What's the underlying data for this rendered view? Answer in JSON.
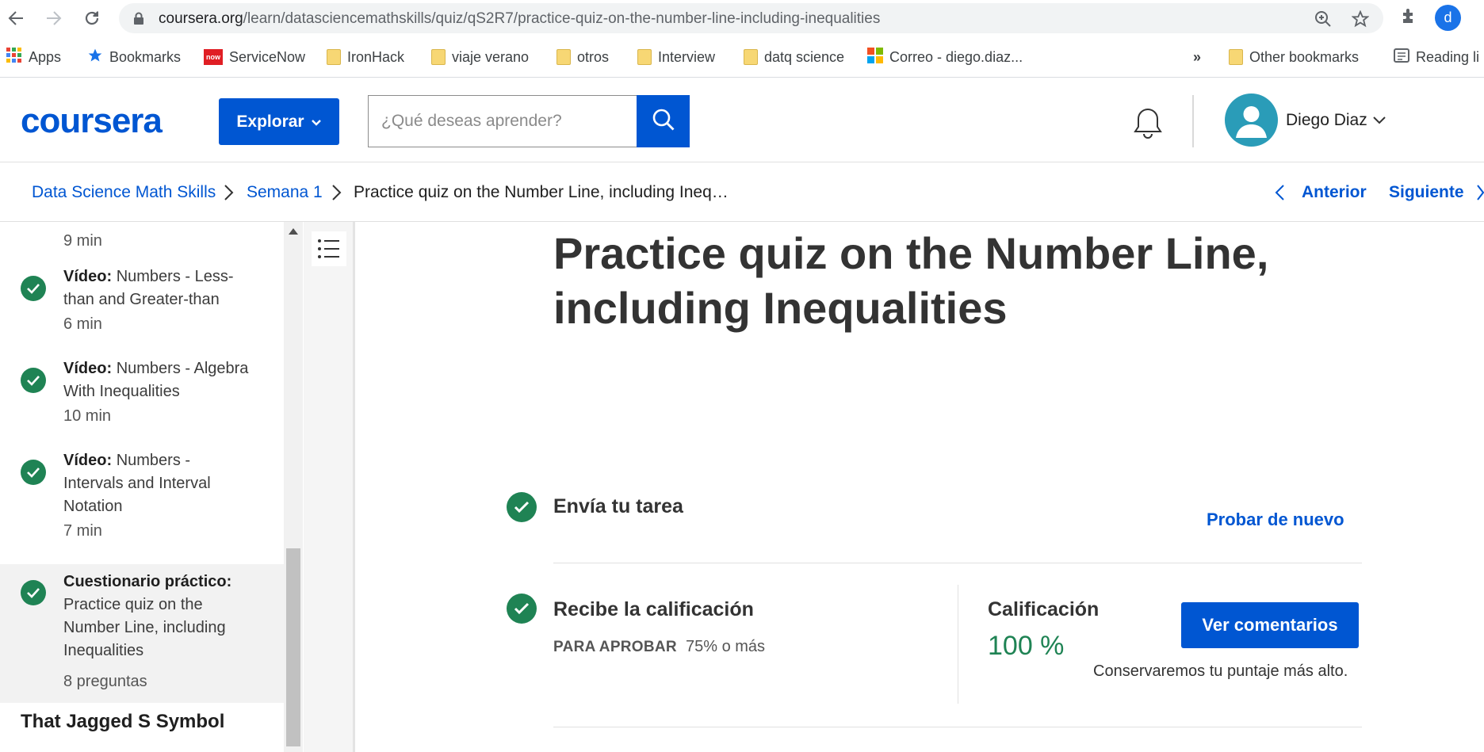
{
  "browser": {
    "url_host": "coursera.org",
    "url_path": "/learn/datasciencemathskills/quiz/qS2R7/practice-quiz-on-the-number-line-including-inequalities",
    "profile_initial": "d"
  },
  "bookmarks": {
    "items": [
      {
        "label": "Apps",
        "icon": "apps-grid-icon"
      },
      {
        "label": "Bookmarks",
        "icon": "star-icon"
      },
      {
        "label": "ServiceNow",
        "icon": "servicenow-icon",
        "badge": "now"
      },
      {
        "label": "IronHack",
        "icon": "folder-icon"
      },
      {
        "label": "viaje verano",
        "icon": "folder-icon"
      },
      {
        "label": "otros",
        "icon": "folder-icon"
      },
      {
        "label": "Interview",
        "icon": "folder-icon"
      },
      {
        "label": "datq science",
        "icon": "folder-icon"
      },
      {
        "label": "Correo - diego.diaz...",
        "icon": "microsoft-icon"
      }
    ],
    "overflow": "»",
    "other": "Other bookmarks",
    "reading": "Reading li"
  },
  "header": {
    "logo": "coursera",
    "explore_label": "Explorar",
    "search_placeholder": "¿Qué deseas aprender?",
    "user_name": "Diego Diaz"
  },
  "breadcrumb": {
    "course": "Data Science Math Skills",
    "week": "Semana 1",
    "current": "Practice quiz on the Number Line, including Ineq…",
    "prev": "Anterior",
    "next": "Siguiente"
  },
  "sidebar": {
    "top_duration": "9 min",
    "items": [
      {
        "type": "Vídeo:",
        "title": "Numbers - Less-than and Greater-than",
        "duration": "6 min"
      },
      {
        "type": "Vídeo:",
        "title": "Numbers - Algebra With Inequalities",
        "duration": "10 min"
      },
      {
        "type": "Vídeo:",
        "title": "Numbers - Intervals and Interval Notation",
        "duration": "7 min"
      },
      {
        "type": "Cuestionario práctico:",
        "title": "Practice quiz on the Number Line, including Inequalities",
        "duration": "8 preguntas"
      }
    ],
    "next_section": "That Jagged S Symbol"
  },
  "main": {
    "title": "Practice quiz on the Number Line, including Inequalities",
    "submit_title": "Envía tu tarea",
    "retry": "Probar de nuevo",
    "receive_title": "Recibe la calificación",
    "pass_label": "PARA APROBAR",
    "pass_value": "75% o más",
    "grade_label": "Calificación",
    "grade_value": "100 %",
    "feedback_button": "Ver comentarios",
    "keep_note": "Conservaremos tu puntaje más alto."
  }
}
